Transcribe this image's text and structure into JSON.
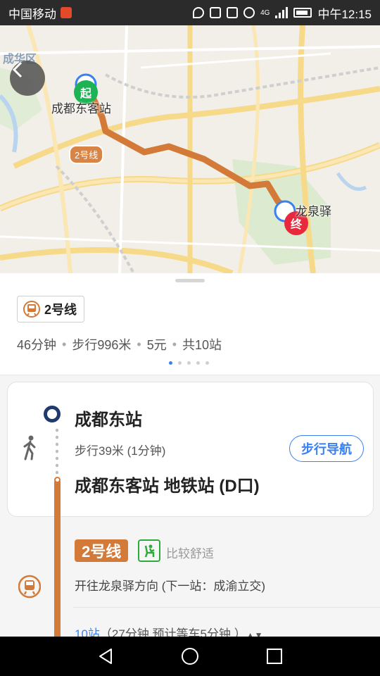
{
  "status_bar": {
    "carrier": "中国移动",
    "net": "4G",
    "time": "中午12:15"
  },
  "map": {
    "district": "成华区",
    "start_station": "成都东客站",
    "end_station": "龙泉驿",
    "start_pin": "起",
    "end_pin": "终",
    "line_tag": "2号线",
    "colors": {
      "route": "#d37a39",
      "start": "#1db254",
      "end": "#e8283c"
    }
  },
  "sheet": {
    "line_chip": "2号线",
    "summary": [
      "46分钟",
      "步行996米",
      "5元",
      "共10站"
    ],
    "pager": {
      "count": 5,
      "active": 0
    },
    "walk": {
      "from": "成都东站",
      "info": "步行39米 (1分钟)",
      "nav_button": "步行导航",
      "to": "成都东客站 地铁站 (D口)"
    },
    "metro": {
      "line": "2号线",
      "comfort": "比较舒适",
      "direction": "开往龙泉驿方向 (下一站：成渝立交)",
      "stations_count": "10站",
      "stations_detail": "（27分钟 预计等车5分钟 ）"
    }
  },
  "icons": [
    "back-arrow-icon",
    "walk-icon",
    "metro-train-icon",
    "seat-icon",
    "nav-back-icon",
    "nav-home-icon",
    "nav-recent-icon"
  ]
}
